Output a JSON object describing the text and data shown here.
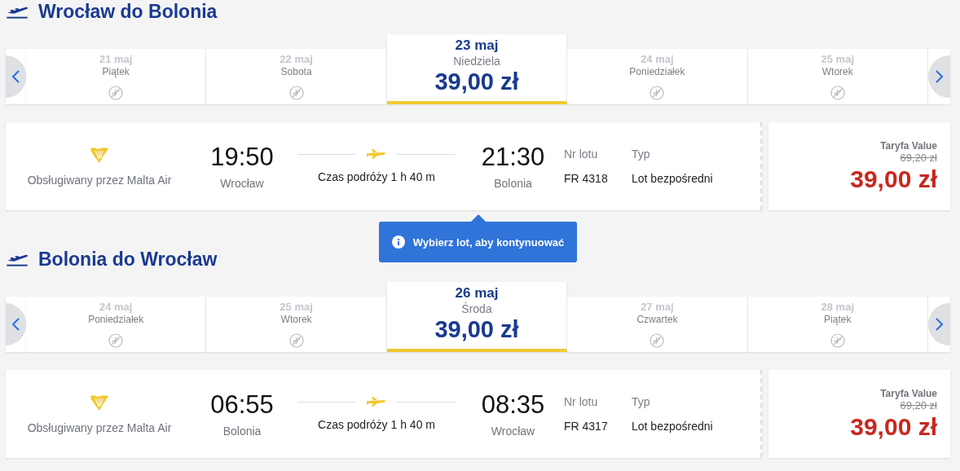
{
  "sections": [
    {
      "title": "Wrocław do Bolonia",
      "dates": [
        {
          "date": "21 maj",
          "day": "Piątek",
          "selected": false
        },
        {
          "date": "22 maj",
          "day": "Sobota",
          "selected": false
        },
        {
          "date": "23 maj",
          "day": "Niedziela",
          "price": "39,00 zł",
          "selected": true
        },
        {
          "date": "24 maj",
          "day": "Poniedziałek",
          "selected": false
        },
        {
          "date": "25 maj",
          "day": "Wtorek",
          "selected": false
        }
      ],
      "flight": {
        "operator": "Obsługiwany przez Malta Air",
        "dep_time": "19:50",
        "dep_city": "Wrocław",
        "duration": "Czas podróży 1 h 40 m",
        "arr_time": "21:30",
        "arr_city": "Bolonia",
        "flight_no_label": "Nr lotu",
        "flight_no": "FR 4318",
        "type_label": "Typ",
        "type": "Lot bezpośredni",
        "fare_label": "Taryfa Value",
        "old_price": "69,20 zł",
        "price": "39,00 zł"
      }
    },
    {
      "title": "Bolonia do Wrocław",
      "dates": [
        {
          "date": "24 maj",
          "day": "Poniedziałek",
          "selected": false
        },
        {
          "date": "25 maj",
          "day": "Wtorek",
          "selected": false
        },
        {
          "date": "26 maj",
          "day": "Środa",
          "price": "39,00 zł",
          "selected": true
        },
        {
          "date": "27 maj",
          "day": "Czwartek",
          "selected": false
        },
        {
          "date": "28 maj",
          "day": "Piątek",
          "selected": false
        }
      ],
      "flight": {
        "operator": "Obsługiwany przez Malta Air",
        "dep_time": "06:55",
        "dep_city": "Bolonia",
        "duration": "Czas podróży 1 h 40 m",
        "arr_time": "08:35",
        "arr_city": "Wrocław",
        "flight_no_label": "Nr lotu",
        "flight_no": "FR 4317",
        "type_label": "Typ",
        "type": "Lot bezpośredni",
        "fare_label": "Taryfa Value",
        "old_price": "69,20 zł",
        "price": "39,00 zł"
      }
    }
  ],
  "tooltip": {
    "text": "Wybierz lot, aby kontynuować"
  }
}
